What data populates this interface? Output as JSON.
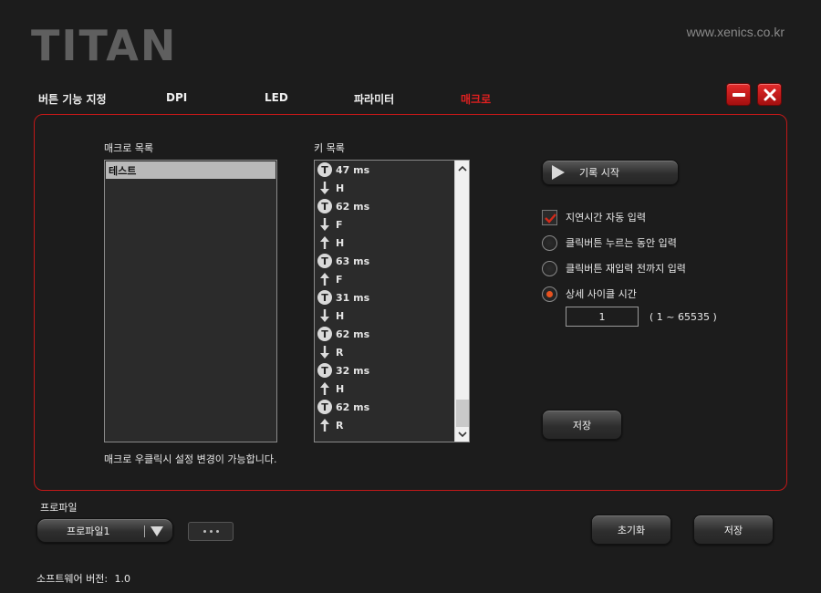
{
  "header": {
    "logo": "TITAN",
    "url": "www.xenics.co.kr"
  },
  "tabs": [
    {
      "label": "버튼 기능 지정",
      "active": false
    },
    {
      "label": "DPI",
      "active": false
    },
    {
      "label": "LED",
      "active": false
    },
    {
      "label": "파라미터",
      "active": false
    },
    {
      "label": "매크로",
      "active": true
    }
  ],
  "macro": {
    "macro_list_label": "매크로 목록",
    "macro_items": [
      "테스트"
    ],
    "key_list_label": "키 목록",
    "keys": [
      {
        "icon": "timer-icon",
        "text": "47 ms"
      },
      {
        "icon": "key-down-arrow-icon",
        "text": "H"
      },
      {
        "icon": "timer-icon",
        "text": "62 ms"
      },
      {
        "icon": "key-down-arrow-icon",
        "text": "F"
      },
      {
        "icon": "key-up-arrow-icon",
        "text": "H"
      },
      {
        "icon": "timer-icon",
        "text": "63 ms"
      },
      {
        "icon": "key-up-arrow-icon",
        "text": "F"
      },
      {
        "icon": "timer-icon",
        "text": "31 ms"
      },
      {
        "icon": "key-down-arrow-icon",
        "text": "H"
      },
      {
        "icon": "timer-icon",
        "text": "62 ms"
      },
      {
        "icon": "key-down-arrow-icon",
        "text": "R"
      },
      {
        "icon": "timer-icon",
        "text": "32 ms"
      },
      {
        "icon": "key-up-arrow-icon",
        "text": "H"
      },
      {
        "icon": "timer-icon",
        "text": "62 ms"
      },
      {
        "icon": "key-up-arrow-icon",
        "text": "R"
      }
    ],
    "hint": "매크로 우클릭시 설정 변경이 가능합니다.",
    "record_button": "기록 시작",
    "delay_auto_label": "지연시간 자동 입력",
    "delay_auto_checked": true,
    "modes": [
      {
        "label": "클릭버튼 누르는 동안 입력",
        "selected": false
      },
      {
        "label": "클릭버튼 재입력 전까지 입력",
        "selected": false
      },
      {
        "label": "상세 사이클 시간",
        "selected": true
      }
    ],
    "cycle_value": "1",
    "cycle_range": "( 1 ~ 65535 )",
    "save_button": "저장"
  },
  "footer": {
    "profile_label": "프로파일",
    "profile_selected": "프로파일1",
    "reset_button": "초기화",
    "save_button": "저장",
    "version_label": "소프트웨어 버전:",
    "version_value": "1.0"
  },
  "colors": {
    "accent": "#e02020",
    "radio_selected": "#e8521f",
    "background": "#1c1c1c"
  }
}
